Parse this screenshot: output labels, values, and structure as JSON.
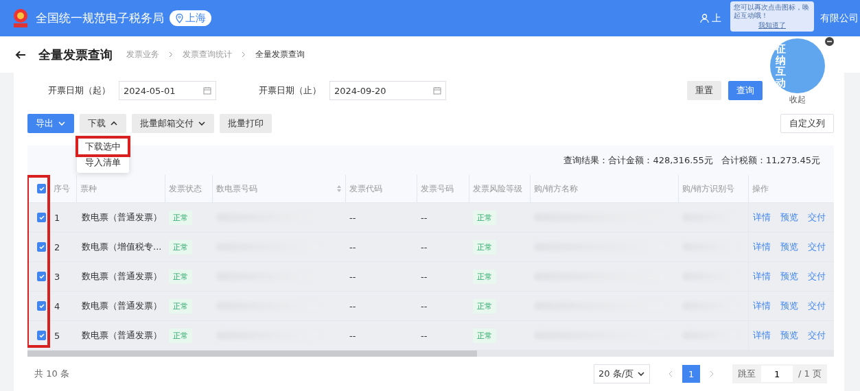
{
  "header": {
    "site_title": "全国统一规范电子税务局",
    "region": "上海",
    "user_name_start": "上",
    "user_name_end": "有限公司"
  },
  "assistant": {
    "tooltip_text": "您可以再次点击图标，唤起互动哦！",
    "tooltip_action": "我知道了",
    "mascot_label": "征纳互动",
    "collapse_label": "收起"
  },
  "page": {
    "title": "全量发票查询",
    "breadcrumb": [
      {
        "label": "发票业务",
        "current": false
      },
      {
        "label": "发票查询统计",
        "current": false
      },
      {
        "label": "全量发票查询",
        "current": true
      }
    ]
  },
  "filters": [
    {
      "label": "开票日期（起）",
      "value": "2024-05-01"
    },
    {
      "label": "开票日期（止）",
      "value": "2024-09-20"
    }
  ],
  "filter_buttons": [
    {
      "label": "重置",
      "kind": "secondary"
    },
    {
      "label": "查询",
      "kind": "primary"
    }
  ],
  "toolbar": [
    {
      "label": "导出",
      "kind": "primary",
      "has_menu": true,
      "expanded": false
    },
    {
      "label": "下载",
      "kind": "secondary",
      "has_menu": true,
      "expanded": true
    },
    {
      "label": "批量邮箱交付",
      "kind": "secondary",
      "has_menu": true,
      "expanded": false
    },
    {
      "label": "批量打印",
      "kind": "secondary",
      "has_menu": false
    }
  ],
  "custom_columns_button": "自定义列",
  "download_menu": {
    "items": [
      {
        "label": "下载选中",
        "highlighted": true
      },
      {
        "label": "导入清单",
        "highlighted": false
      }
    ]
  },
  "summary": {
    "result_label": "查询结果：合计金额：428,316.55元",
    "tax_label": "合计税额：11,273.45元"
  },
  "table": {
    "select_all": true,
    "checkbox_column_highlighted": true,
    "columns": [
      "序号",
      "票种",
      "发票状态",
      "数电票号码",
      "发票代码",
      "发票号码",
      "发票风险等级",
      "购/销方名称",
      "购/销方识别号",
      "操作"
    ],
    "rows": [
      {
        "selected": true,
        "index": "1",
        "type": "数电票（普通发票）",
        "status": "正常",
        "code": "--",
        "number": "--",
        "risk": "正常",
        "actions": [
          "详情",
          "预览",
          "交付"
        ]
      },
      {
        "selected": true,
        "index": "2",
        "type": "数电票（增值税专...",
        "status": "正常",
        "code": "--",
        "number": "--",
        "risk": "正常",
        "actions": [
          "详情",
          "预览",
          "交付"
        ]
      },
      {
        "selected": true,
        "index": "3",
        "type": "数电票（普通发票）",
        "status": "正常",
        "code": "--",
        "number": "--",
        "risk": "正常",
        "actions": [
          "详情",
          "预览",
          "交付"
        ]
      },
      {
        "selected": true,
        "index": "4",
        "type": "数电票（普通发票）",
        "status": "正常",
        "code": "--",
        "number": "--",
        "risk": "正常",
        "actions": [
          "详情",
          "预览",
          "交付"
        ]
      },
      {
        "selected": true,
        "index": "5",
        "type": "数电票（普通发票）",
        "status": "正常",
        "code": "--",
        "number": "--",
        "risk": "正常",
        "actions": [
          "详情",
          "预览",
          "交付"
        ]
      }
    ]
  },
  "footer": {
    "total": "共 10 条",
    "page_size": "20 条/页",
    "pages": [
      {
        "label": "1",
        "selected": true
      }
    ],
    "jump_label": "跳至",
    "jump_value": "1",
    "page_count": "/ 1 页"
  }
}
